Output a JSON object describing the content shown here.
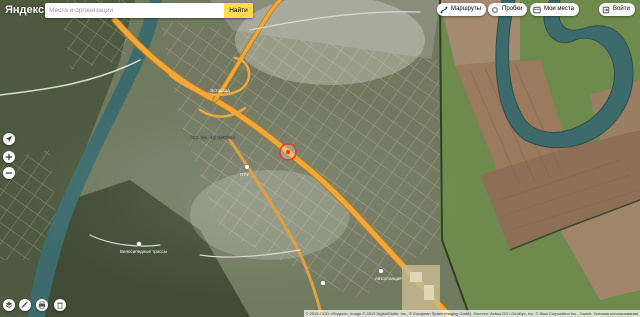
{
  "app": {
    "logo": "Яндекс"
  },
  "search": {
    "placeholder": "Места и организации",
    "button_label": "Найти"
  },
  "toolbar": {
    "routes": "Маршруты",
    "traffic": "Пробки",
    "my_places": "Мои места",
    "login": "Войти"
  },
  "map": {
    "labels": {
      "settlement": "пос. им. Артамонов",
      "ptu": "ПТУ",
      "sports_base": "Велосипедные трассы",
      "flyover": "Эстакада",
      "stop": "Автостанция"
    }
  },
  "copyright": "© 2013 ООО «Яндекс», Image © 2013 DigitalGlobe, Inc., © European Space Imaging GmbH, Sources: Airbus DS / GeoEye, Inc. © Iflow Corporation Inc., Carmit. Условия использования",
  "icons": [
    "search-icon",
    "route-icon",
    "traffic-icon",
    "bookmark-icon",
    "login-icon",
    "locate-icon",
    "zoom-in-icon",
    "zoom-out-icon",
    "layers-icon",
    "ruler-icon",
    "print-icon",
    "share-icon",
    "trash-icon",
    "location-pin-icon"
  ],
  "colors": {
    "search_button": "#ffdb4d",
    "road": "#f0a83a",
    "river": "#3d6b6b",
    "field": "#9b7a5e"
  }
}
